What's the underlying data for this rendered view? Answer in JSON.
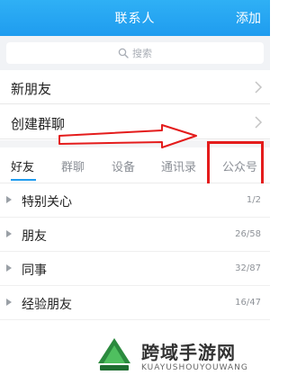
{
  "header": {
    "title": "联系人",
    "action": "添加"
  },
  "search": {
    "placeholder": "搜索"
  },
  "menu": [
    {
      "label": "新朋友"
    },
    {
      "label": "创建群聊"
    }
  ],
  "tabs": [
    {
      "label": "好友",
      "active": true
    },
    {
      "label": "群聊"
    },
    {
      "label": "设备"
    },
    {
      "label": "通讯录"
    },
    {
      "label": "公众号"
    }
  ],
  "groups": [
    {
      "name": "特别关心",
      "count": "1/2"
    },
    {
      "name": "朋友",
      "count": "26/58"
    },
    {
      "name": "同事",
      "count": "32/87"
    },
    {
      "name": "经验朋友",
      "count": "16/47"
    }
  ],
  "watermark": {
    "title": "跨域手游网",
    "subtitle": "KUAYUSHOUYOUWANG"
  },
  "colors": {
    "accent": "#1f9cef",
    "annotation": "#e41c1c"
  }
}
